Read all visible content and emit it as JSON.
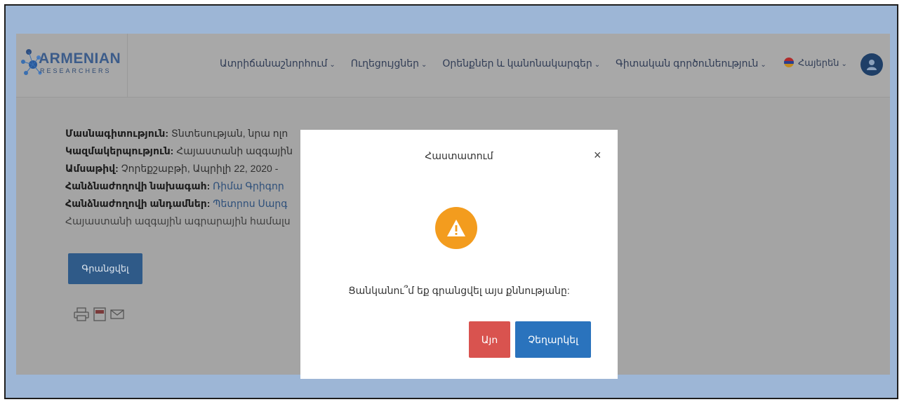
{
  "logo": {
    "name": "ARMENIAN",
    "sub": "RESEARCHERS"
  },
  "nav": {
    "items": [
      "Ատրիճանաշնորհում",
      "Ուղեցույցներ",
      "Օրենքներ և կանոնակարգեր",
      "Գիտական գործունեություն"
    ],
    "language": "Հայերեն"
  },
  "content": {
    "specialty_label": "Մասնագիտություն:",
    "specialty_value": "Տնտեսության, նրա ոլո",
    "organization_label": "Կազմակերպություն:",
    "organization_value": "Հայաստանի ազգային",
    "date_label": "Ամսաթիվ:",
    "date_value": "Չորեքշաբթի, Ապրիլի 22, 2020 -",
    "chair_label": "Հանձնաժողովի նախագահ:",
    "chair_value": "Ռիմա Գրիգոր",
    "members_label": "Հանձնաժողովի անդամներ:",
    "members_value": "Պետրոս Սարգ",
    "note": "Հայաստանի ազգային ագրարային համալս",
    "register_button": "Գրանցվել"
  },
  "modal": {
    "title": "Հաստատում",
    "close": "×",
    "message": "Ցանկանու՞մ եք գրանցվել այս քննությանը:",
    "yes": "Այո",
    "cancel": "Չեղարկել"
  },
  "colors": {
    "frame_bg": "#9db6d6",
    "warning": "#f39c1e",
    "yes_button": "#d9534f",
    "cancel_button": "#2a73bd"
  }
}
